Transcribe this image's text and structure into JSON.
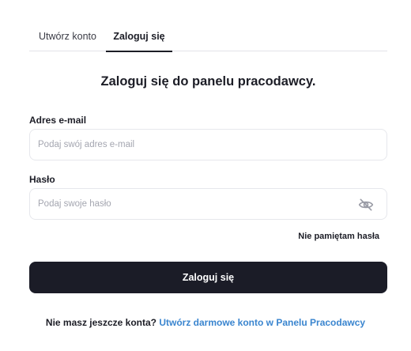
{
  "tabs": {
    "register_label": "Utwórz konto",
    "login_label": "Zaloguj się",
    "active": "login"
  },
  "form": {
    "heading": "Zaloguj się do panelu pracodawcy.",
    "email": {
      "label": "Adres e-mail",
      "value": "",
      "placeholder": "Podaj swój adres e-mail"
    },
    "password": {
      "label": "Hasło",
      "value": "",
      "placeholder": "Podaj swoje hasło",
      "toggle_icon": "eye-off-icon"
    },
    "forgot_label": "Nie pamiętam hasła",
    "submit_label": "Zaloguj się"
  },
  "footer": {
    "question": "Nie masz jeszcze konta?",
    "link_label": "Utwórz darmowe konto w Panelu Pracodawcy"
  },
  "colors": {
    "primary_button": "#1b1c27",
    "link": "#3a85cf",
    "border": "#e6e7ec"
  }
}
